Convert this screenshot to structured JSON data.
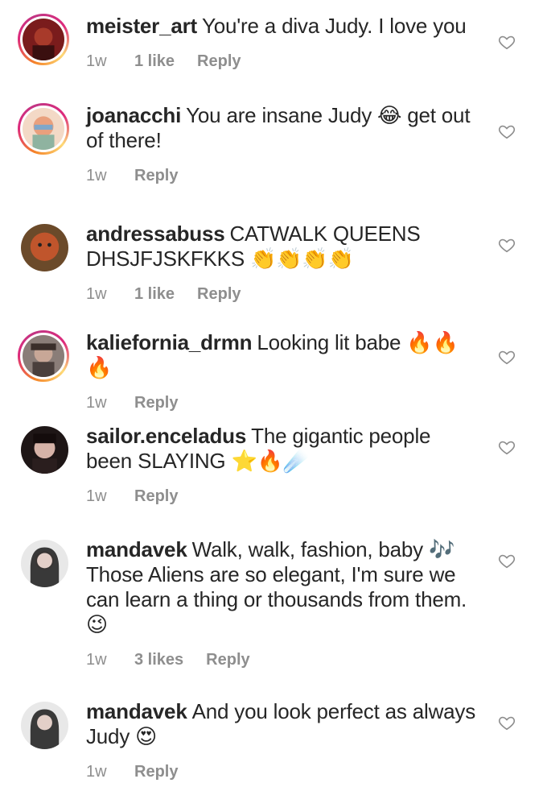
{
  "comments": [
    {
      "username": "meister_art",
      "text": "You're a diva Judy. I love you",
      "time": "1w",
      "likes": "1 like",
      "reply": "Reply",
      "ring": true,
      "avatar_color": "#7a1c1c"
    },
    {
      "username": "joanacchi",
      "text": "You are insane Judy 😂 get out of there!",
      "time": "1w",
      "likes": "",
      "reply": "Reply",
      "ring": true,
      "avatar_color": "#e9a07d"
    },
    {
      "username": "andressabuss",
      "text": "CATWALK QUEENS DHSJFJSKFKKS 👏👏👏👏",
      "time": "1w",
      "likes": "1 like",
      "reply": "Reply",
      "ring": false,
      "avatar_color": "#b5502a"
    },
    {
      "username": "kaliefornia_drmn",
      "text": "Looking lit babe 🔥🔥🔥",
      "time": "1w",
      "likes": "",
      "reply": "Reply",
      "ring": true,
      "avatar_color": "#5a4a44"
    },
    {
      "username": "sailor.enceladus",
      "text": "The gigantic people been SLAYING ⭐🔥☄️",
      "time": "1w",
      "likes": "",
      "reply": "Reply",
      "ring": false,
      "avatar_color": "#3b2a2a"
    },
    {
      "username": "mandavek",
      "text": "Walk, walk, fashion, baby 🎶 Those Aliens are so elegant, I'm sure we can learn a thing or thousands from them. 😉",
      "time": "1w",
      "likes": "3 likes",
      "reply": "Reply",
      "ring": false,
      "avatar_color": "#2a2a2a"
    },
    {
      "username": "mandavek",
      "text": "And you look perfect as always Judy 😍",
      "time": "1w",
      "likes": "",
      "reply": "Reply",
      "ring": false,
      "avatar_color": "#2a2a2a"
    }
  ],
  "colors": {
    "text": "#262626",
    "meta": "#8e8e8e",
    "heart_outline": "#8e8e8e"
  },
  "icons": {
    "like": "heart-outline-icon"
  }
}
